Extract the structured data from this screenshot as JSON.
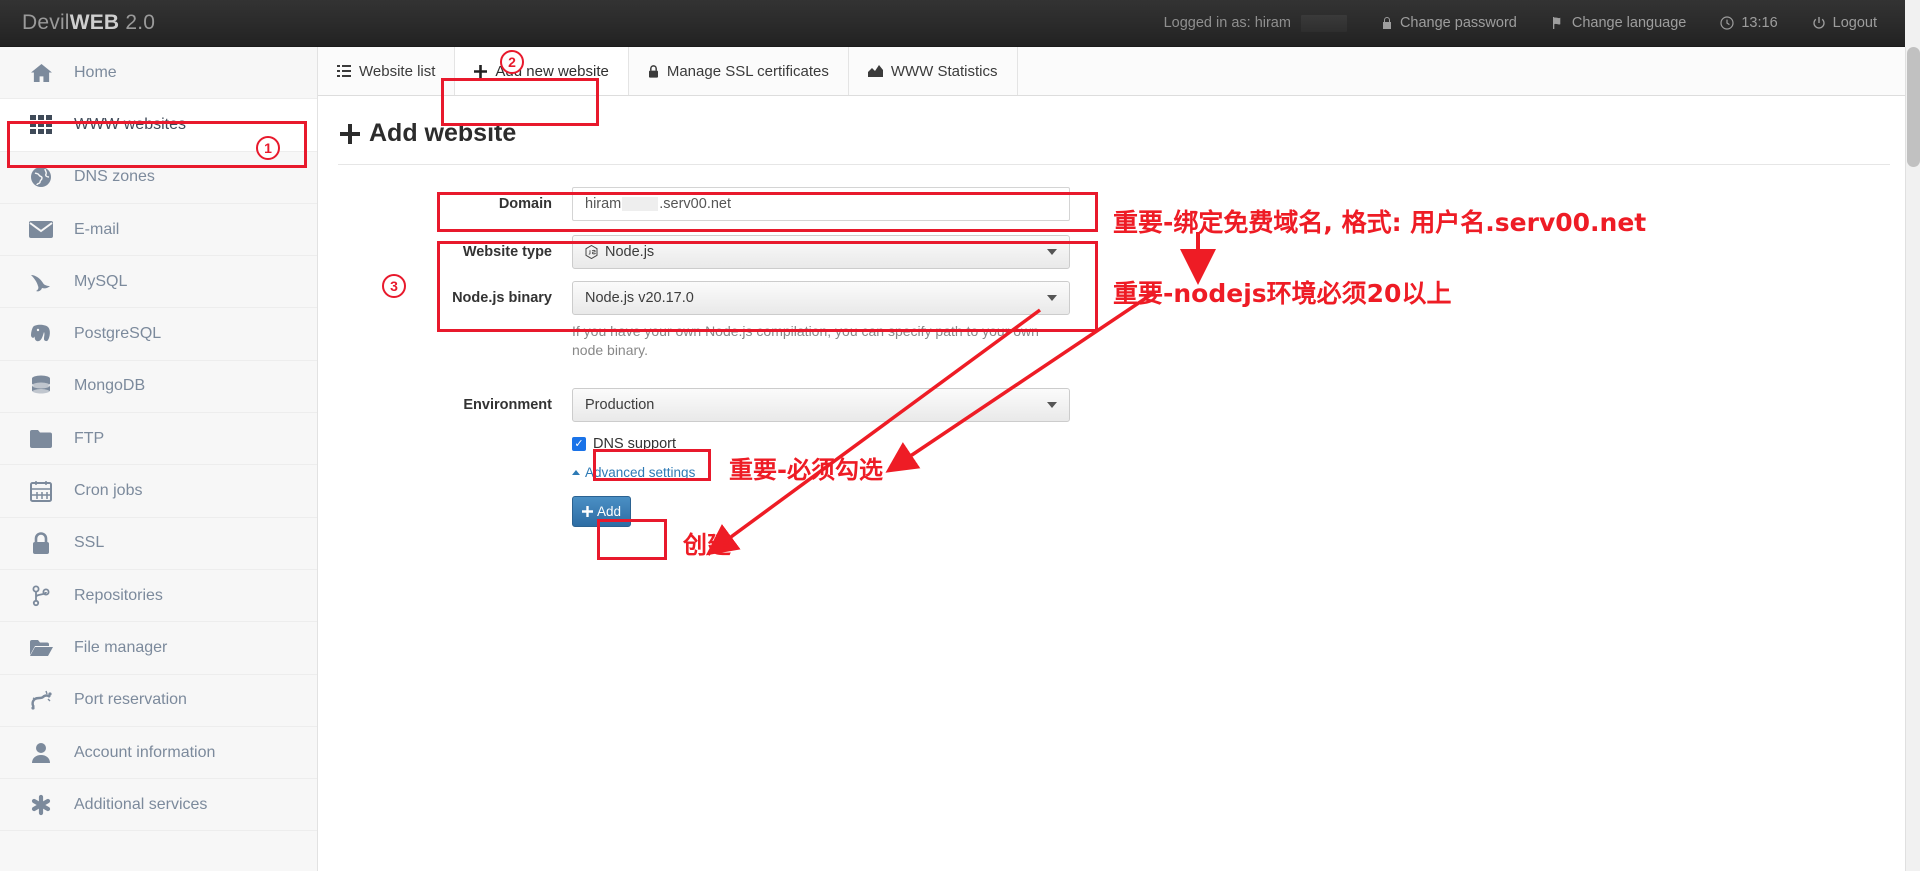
{
  "header": {
    "brand_prefix": "Devil",
    "brand_bold": "WEB",
    "brand_suffix": " 2.0",
    "logged_in_label": "Logged in as: hiram",
    "change_password": "Change password",
    "change_language": "Change language",
    "clock": "13:16",
    "logout": "Logout"
  },
  "sidebar": {
    "items": [
      {
        "label": "Home",
        "icon": "home-icon"
      },
      {
        "label": "WWW websites",
        "icon": "grid-icon"
      },
      {
        "label": "DNS zones",
        "icon": "globe-icon"
      },
      {
        "label": "E-mail",
        "icon": "envelope-icon"
      },
      {
        "label": "MySQL",
        "icon": "dolphin-icon"
      },
      {
        "label": "PostgreSQL",
        "icon": "elephant-icon"
      },
      {
        "label": "MongoDB",
        "icon": "database-icon"
      },
      {
        "label": "FTP",
        "icon": "folder-icon"
      },
      {
        "label": "Cron jobs",
        "icon": "calendar-icon"
      },
      {
        "label": "SSL",
        "icon": "lock-icon"
      },
      {
        "label": "Repositories",
        "icon": "code-branch-icon"
      },
      {
        "label": "File manager",
        "icon": "folder-open-icon"
      },
      {
        "label": "Port reservation",
        "icon": "network-icon"
      },
      {
        "label": "Account information",
        "icon": "user-icon"
      },
      {
        "label": "Additional services",
        "icon": "asterisk-icon"
      }
    ],
    "active": "WWW websites"
  },
  "tabs": [
    {
      "label": "Website list",
      "icon": "list-icon",
      "active": false
    },
    {
      "label": "Add new website",
      "icon": "plus-icon",
      "active": true
    },
    {
      "label": "Manage SSL certificates",
      "icon": "lock-icon",
      "active": false
    },
    {
      "label": "WWW Statistics",
      "icon": "chart-icon",
      "active": false
    }
  ],
  "main": {
    "page_title": "Add website",
    "domain": {
      "label": "Domain",
      "value_prefix": "hiram",
      "value_suffix": ".serv00.net"
    },
    "website_type": {
      "label": "Website type",
      "value": "Node.js"
    },
    "node_binary": {
      "label": "Node.js binary",
      "value": "Node.js v20.17.0",
      "help": "If you have your own Node.js compilation, you can specify path to your own node binary."
    },
    "environment": {
      "label": "Environment",
      "value": "Production"
    },
    "dns_support": {
      "label": "DNS support",
      "checked": true
    },
    "advanced_settings": "Advanced settings",
    "add_button": "Add"
  },
  "annotations": {
    "markers": [
      "1",
      "2",
      "3"
    ],
    "note_domain": "重要-绑定免费域名, 格式: 用户名.serv00.net",
    "note_node": "重要-nodejs环境必须20以上",
    "note_dns": "重要-必须勾选",
    "note_add": "创建",
    "accent_red": "#ee1c25",
    "accent_blue": "#2e6da4"
  }
}
